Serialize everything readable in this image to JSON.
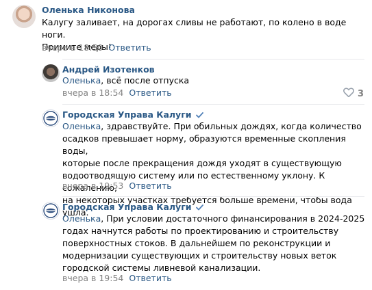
{
  "comments": [
    {
      "author": "Оленька Никонова",
      "text_lines": [
        "Калугу заливает, на дорогах сливы не работают, по колено в воде ноги.",
        "Примите меры!"
      ],
      "time": "вчера в 18:50",
      "reply_label": "Ответить"
    },
    {
      "author": "Андрей Изотенков",
      "reply_to": "Оленька",
      "text": ", всё после отпуска",
      "time": "вчера в 18:54",
      "reply_label": "Ответить",
      "likes": "3"
    },
    {
      "author": "Городская Управа Калуги",
      "verified": true,
      "reply_to": "Оленька",
      "text_lines": [
        ", здравствуйте. При обильных дождях, когда количество",
        "осадков превышает норму, образуются временные скопления воды,",
        "которые после прекращения дождя уходят в существующую",
        "водоотводящую систему или по естественному уклону. К сожалению,",
        "на некоторых участках требуется больше времени, чтобы вода ушла."
      ],
      "time": "вчера в 19:53",
      "reply_label": "Ответить"
    },
    {
      "author": "Городская Управа Калуги",
      "verified": true,
      "reply_to": "Оленька",
      "text_lines": [
        ", При условии достаточного финансирования в 2024-2025",
        "годах начнутся работы по проектированию и строительству",
        "поверхностных стоков. В дальнейшем по реконструкции и",
        "модернизации существующих и строительству новых веток",
        "городской системы ливневой канализации."
      ],
      "time": "вчера в 19:54",
      "reply_label": "Ответить"
    }
  ],
  "colors": {
    "link": "#2a5885",
    "meta": "#828282",
    "divider": "#e7e8ec",
    "verified": "#5181b8"
  }
}
